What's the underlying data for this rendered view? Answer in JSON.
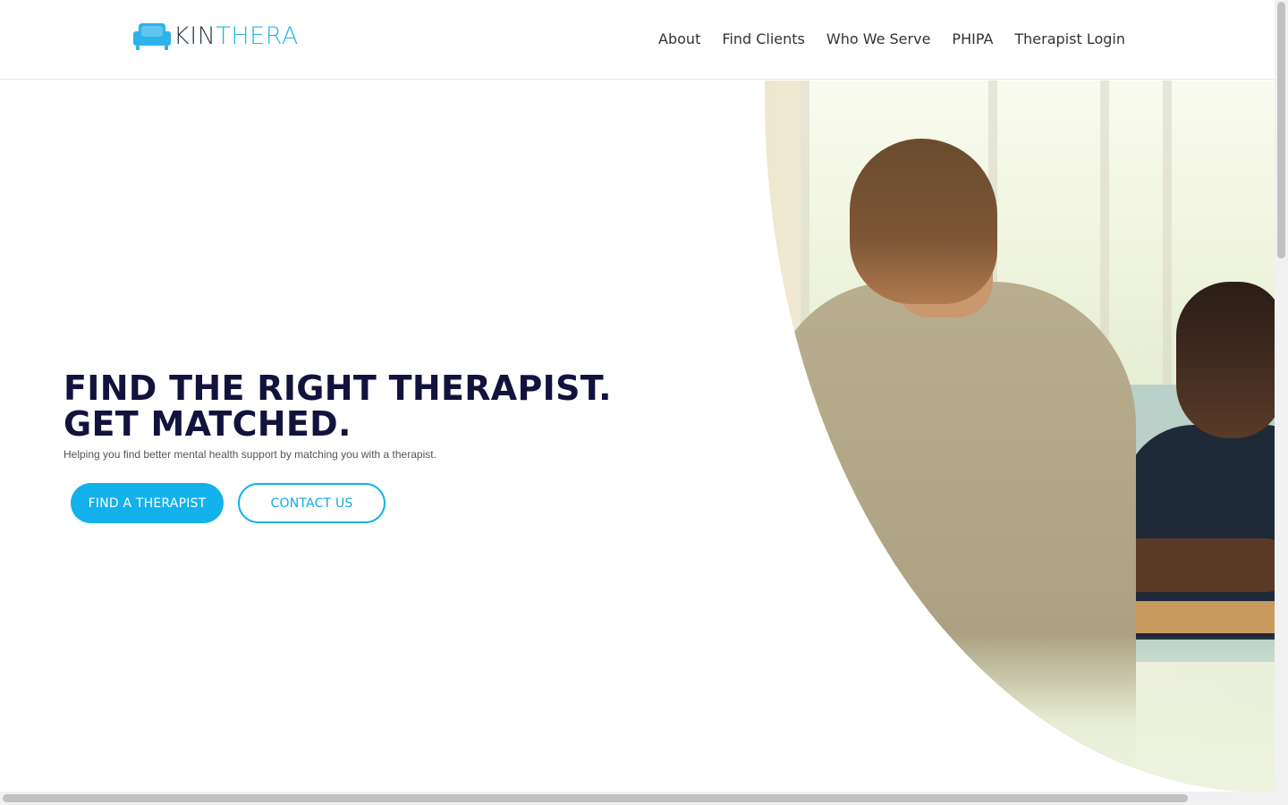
{
  "brand": {
    "name_part1": "KIN",
    "name_part2": "THERA",
    "accent_color": "#2bb3ea",
    "dark_color": "#333d47",
    "icon": "couch-icon"
  },
  "nav": {
    "items": [
      {
        "label": "About"
      },
      {
        "label": "Find Clients"
      },
      {
        "label": "Who We Serve"
      },
      {
        "label": "PHIPA"
      },
      {
        "label": "Therapist Login"
      }
    ]
  },
  "hero": {
    "title_line1": "FIND THE RIGHT THERAPIST.",
    "title_line2": "GET MATCHED.",
    "subtitle": "Helping you find better mental health support by matching you with a therapist.",
    "primary_button": "FIND A THERAPIST",
    "secondary_button": "CONTACT US",
    "title_color": "#12133d",
    "button_color": "#12b1ec",
    "image_description_icon": "photo-therapy-session"
  }
}
